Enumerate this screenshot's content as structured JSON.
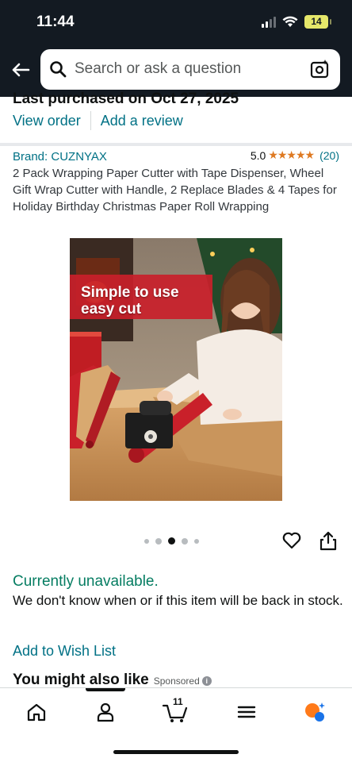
{
  "status_bar": {
    "time": "11:44",
    "battery": "14"
  },
  "search": {
    "placeholder": "Search or ask a question"
  },
  "order": {
    "last_purchased": "Last purchased on Oct 27, 2025",
    "view_order": "View order",
    "add_review": "Add a review"
  },
  "product": {
    "brand": "Brand: CUZNYAX",
    "rating": "5.0",
    "stars": "★★★★★",
    "rating_count": "(20)",
    "title": "2 Pack Wrapping Paper Cutter with Tape Dispenser, Wheel Gift Wrap Cutter with Handle, 2 Replace Blades & 4 Tapes for Holiday Birthday Christmas Paper Roll Wrapping",
    "image_caption_line1": "Simple to use",
    "image_caption_line2": "easy cut",
    "image_count": 5,
    "active_image_index": 2
  },
  "availability": {
    "status": "Currently unavailable.",
    "description": "We don't know when or if this item will be back in stock.",
    "wishlist": "Add to Wish List"
  },
  "recommendations": {
    "heading": "You might also like",
    "sponsored": "Sponsored"
  },
  "bottom_nav": {
    "cart_count": "11",
    "items": [
      "home",
      "account",
      "cart",
      "menu",
      "rufus"
    ]
  },
  "colors": {
    "header_bg": "#131a22",
    "link": "#007185",
    "available_green": "#067d62",
    "star": "#de7921"
  }
}
